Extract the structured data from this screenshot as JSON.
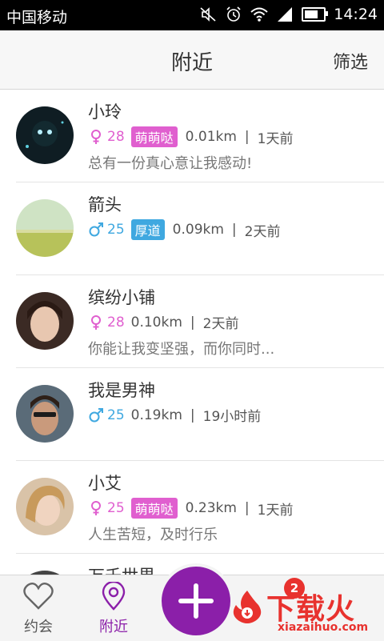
{
  "status_bar": {
    "carrier": "中国移动",
    "time": "14:24"
  },
  "header": {
    "title": "附近",
    "filter_label": "筛选"
  },
  "users": [
    {
      "name": "小玲",
      "gender": "female",
      "age": "28",
      "tag": "萌萌哒",
      "tag_color": "#e05fcf",
      "distance": "0.01km",
      "time": "1天前",
      "signature": "总有一份真心意让我感动!"
    },
    {
      "name": "箭头",
      "gender": "male",
      "age": "25",
      "tag": "厚道",
      "tag_color": "#3fa8e0",
      "distance": "0.09km",
      "time": "2天前",
      "signature": ""
    },
    {
      "name": "缤纷小铺",
      "gender": "female",
      "age": "28",
      "tag": "",
      "tag_color": "",
      "distance": "0.10km",
      "time": "2天前",
      "signature": "你能让我变坚强，而你同时..."
    },
    {
      "name": "我是男神",
      "gender": "male",
      "age": "25",
      "tag": "",
      "tag_color": "",
      "distance": "0.19km",
      "time": "19小时前",
      "signature": ""
    },
    {
      "name": "小艾",
      "gender": "female",
      "age": "25",
      "tag": "萌萌哒",
      "tag_color": "#e05fcf",
      "distance": "0.23km",
      "time": "1天前",
      "signature": "人生苦短，及时行乐"
    },
    {
      "name": "万千世界",
      "gender": "",
      "age": "",
      "tag": "",
      "tag_color": "",
      "distance": "",
      "time": "",
      "signature": ""
    }
  ],
  "tabs": [
    {
      "label": "约会",
      "icon": "heart-icon"
    },
    {
      "label": "附近",
      "icon": "location-pin-icon",
      "active": true
    }
  ],
  "fab_icon": "plus-icon",
  "badge_count": "2",
  "watermark": {
    "text": "下载火",
    "sub": "xiazaihuo.com"
  },
  "colors": {
    "accent": "#8b1fa9",
    "female": "#e05fcf",
    "male": "#3fa8e0",
    "badge": "#e8322e"
  }
}
